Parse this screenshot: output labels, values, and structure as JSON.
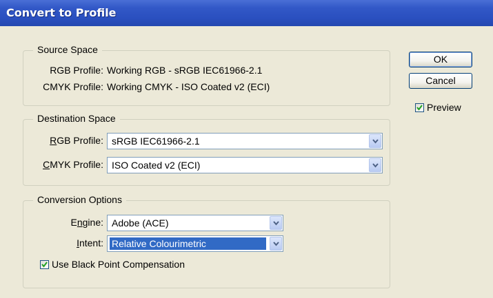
{
  "window": {
    "title": "Convert to Profile"
  },
  "source_space": {
    "legend": "Source Space",
    "rgb_label": "RGB Profile:",
    "rgb_value": "Working RGB - sRGB IEC61966-2.1",
    "cmyk_label": "CMYK Profile:",
    "cmyk_value": "Working CMYK - ISO Coated v2 (ECI)"
  },
  "destination_space": {
    "legend": "Destination Space",
    "rgb_label_mnemonic": "R",
    "rgb_label_rest": "GB Profile:",
    "rgb_value": "sRGB IEC61966-2.1",
    "cmyk_label_mnemonic": "C",
    "cmyk_label_rest": "MYK Profile:",
    "cmyk_value": "ISO Coated v2 (ECI)"
  },
  "conversion_options": {
    "legend": "Conversion Options",
    "engine_label_pre": "E",
    "engine_label_mnemonic": "n",
    "engine_label_rest": "gine:",
    "engine_value": "Adobe (ACE)",
    "intent_label_mnemonic": "I",
    "intent_label_rest": "ntent:",
    "intent_value": "Relative Colourimetric",
    "bpc_label": "Use Black Point Compensation",
    "bpc_checked": true
  },
  "buttons": {
    "ok": "OK",
    "cancel": "Cancel"
  },
  "preview": {
    "label": "Preview",
    "checked": true
  },
  "colors": {
    "title_bar": "#2a4fbf",
    "selection": "#316ac5",
    "dialog_bg": "#ece9d8"
  }
}
